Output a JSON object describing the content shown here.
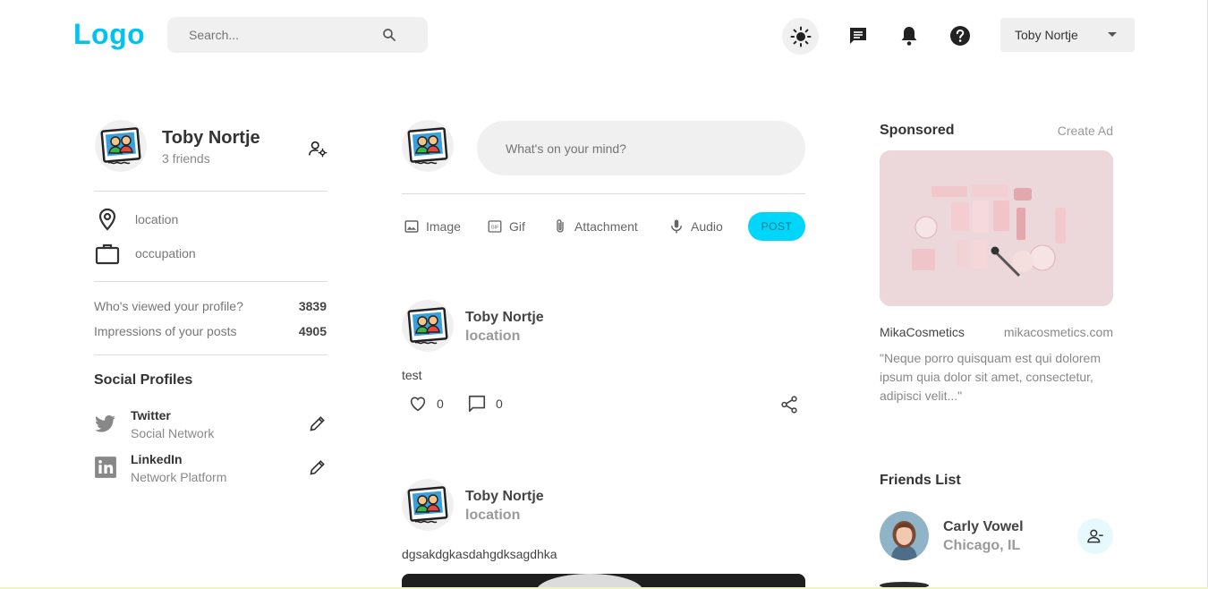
{
  "nav": {
    "logo": "Logo",
    "search_placeholder": "Search...",
    "user_select_value": "Toby Nortje",
    "icons": [
      "sun-icon",
      "message-icon",
      "bell-icon",
      "help-icon",
      "search-icon"
    ]
  },
  "profile": {
    "name": "Toby Nortje",
    "friends": "3 friends",
    "location": "location",
    "occupation": "occupation",
    "stats": [
      {
        "label": "Who's viewed your profile?",
        "value": "3839"
      },
      {
        "label": "Impressions of your posts",
        "value": "4905"
      }
    ],
    "social_title": "Social Profiles",
    "social": [
      {
        "name": "Twitter",
        "sub": "Social Network",
        "icon": "twitter-icon"
      },
      {
        "name": "LinkedIn",
        "sub": "Network Platform",
        "icon": "linkedin-icon"
      }
    ]
  },
  "composer": {
    "placeholder": "What's on your mind?",
    "tools": [
      "Image",
      "Gif",
      "Attachment",
      "Audio"
    ],
    "post_label": "POST"
  },
  "posts": [
    {
      "author": "Toby Nortje",
      "location": "location",
      "text": "test",
      "likes": "0",
      "comments": "0"
    },
    {
      "author": "Toby Nortje",
      "location": "location",
      "text": "dgsakdgkasdahgdksagdhka"
    }
  ],
  "sponsored": {
    "title": "Sponsored",
    "create_ad": "Create Ad",
    "brand": "MikaCosmetics",
    "url": "mikacosmetics.com",
    "description": "\"Neque porro quisquam est qui dolorem ipsum quia dolor sit amet, consectetur, adipisci velit...\""
  },
  "friends_list": {
    "title": "Friends List",
    "friends": [
      {
        "name": "Carly Vowel",
        "location": "Chicago, IL"
      }
    ]
  },
  "colors": {
    "brand": "#00c3f0",
    "post_button": "#00d5fa",
    "remove_friend_bg": "#e6f9fd"
  }
}
